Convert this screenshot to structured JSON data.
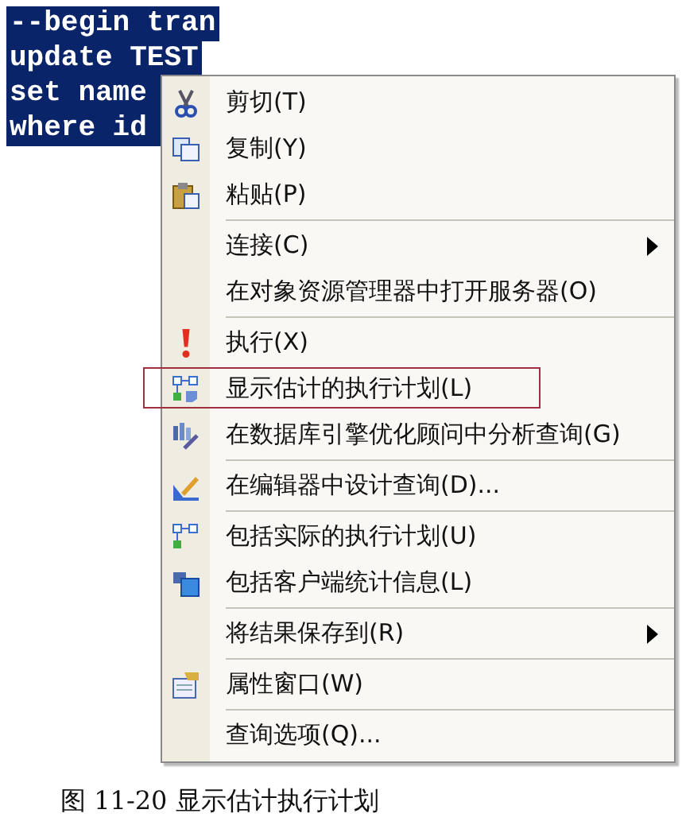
{
  "editor": {
    "lines": [
      "--begin tran",
      "update TEST",
      "set name",
      "where id"
    ]
  },
  "context_menu": {
    "items": [
      {
        "kind": "item",
        "label": "剪切(T)",
        "submenu": false,
        "highlighted": false
      },
      {
        "kind": "item",
        "label": "复制(Y)",
        "submenu": false,
        "highlighted": false
      },
      {
        "kind": "item",
        "label": "粘贴(P)",
        "submenu": false,
        "highlighted": false
      },
      {
        "kind": "separator"
      },
      {
        "kind": "item",
        "label": "连接(C)",
        "submenu": true,
        "highlighted": false
      },
      {
        "kind": "item",
        "label": "在对象资源管理器中打开服务器(O)",
        "submenu": false,
        "highlighted": false
      },
      {
        "kind": "separator"
      },
      {
        "kind": "item",
        "label": "执行(X)",
        "submenu": false,
        "highlighted": false
      },
      {
        "kind": "item",
        "label": "显示估计的执行计划(L)",
        "submenu": false,
        "highlighted": true
      },
      {
        "kind": "item",
        "label": "在数据库引擎优化顾问中分析查询(G)",
        "submenu": false,
        "highlighted": false
      },
      {
        "kind": "separator"
      },
      {
        "kind": "item",
        "label": "在编辑器中设计查询(D)...",
        "submenu": false,
        "highlighted": false
      },
      {
        "kind": "separator"
      },
      {
        "kind": "item",
        "label": "包括实际的执行计划(U)",
        "submenu": false,
        "highlighted": false
      },
      {
        "kind": "item",
        "label": "包括客户端统计信息(L)",
        "submenu": false,
        "highlighted": false
      },
      {
        "kind": "separator"
      },
      {
        "kind": "item",
        "label": "将结果保存到(R)",
        "submenu": true,
        "highlighted": false
      },
      {
        "kind": "separator"
      },
      {
        "kind": "item",
        "label": "属性窗口(W)",
        "submenu": false,
        "highlighted": false
      },
      {
        "kind": "separator"
      },
      {
        "kind": "item",
        "label": "查询选项(Q)...",
        "submenu": false,
        "highlighted": false
      }
    ]
  },
  "caption": "图 11-20 显示估计执行计划"
}
